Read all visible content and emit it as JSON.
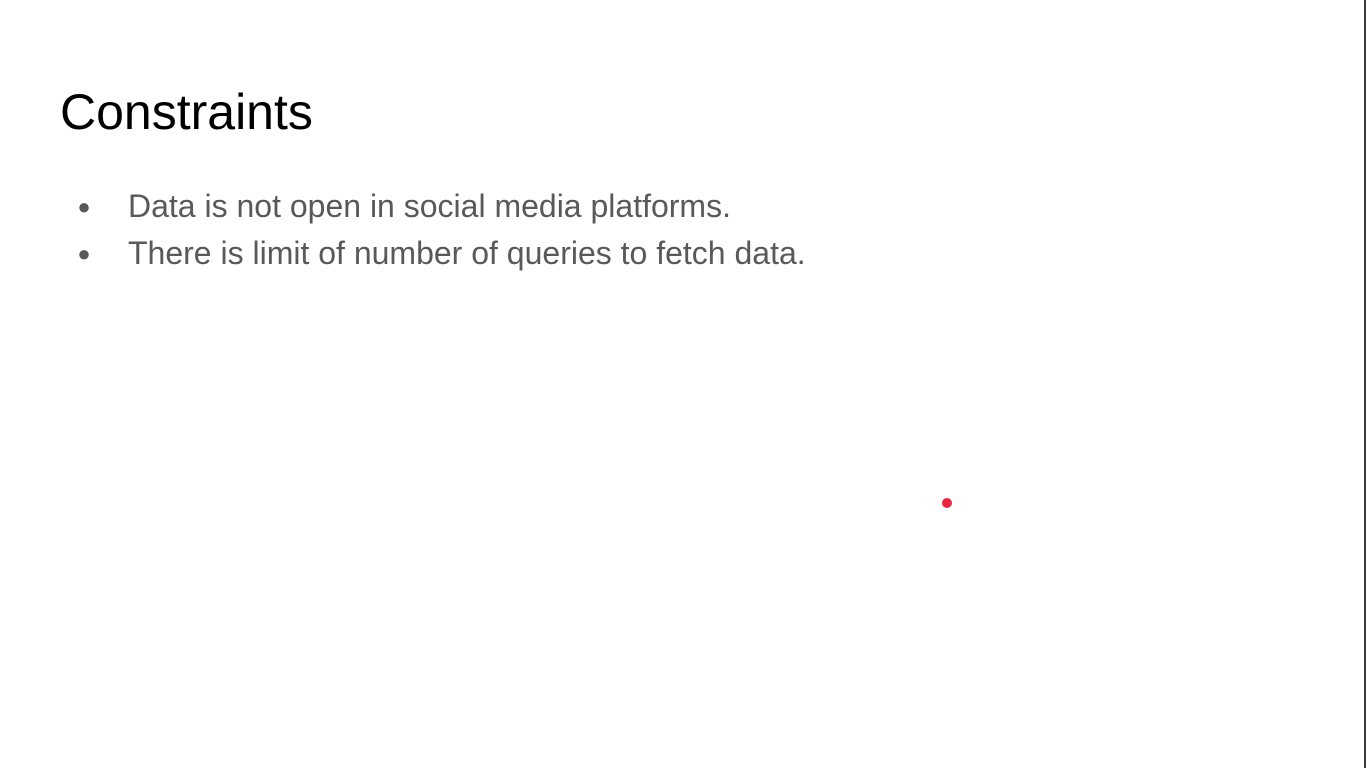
{
  "slide": {
    "title": "Constraints",
    "bullets": [
      "Data is not open in social media platforms.",
      "There is limit of number of queries to fetch data."
    ],
    "bullet_glyph": "●"
  },
  "colors": {
    "background": "#ffffff",
    "title": "#000000",
    "body_text": "#595959",
    "pointer": "#e8263f"
  },
  "icons": {
    "pointer": "laser-pointer-dot"
  }
}
